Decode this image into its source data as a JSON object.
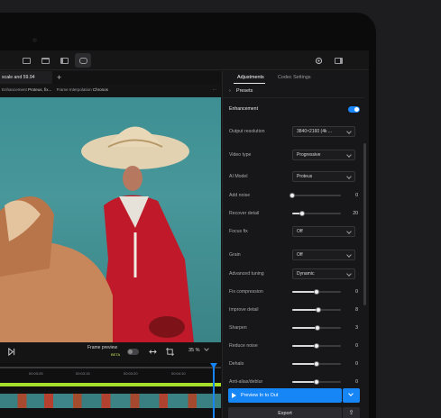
{
  "left": {
    "tab_label": "scale and 59.94",
    "info": {
      "enhancement_label": "Enhancement",
      "enhancement_value": "Proteus, fix...",
      "interp_label": "Frame Interpolation",
      "interp_value": "Chronos",
      "more": "···"
    },
    "controls": {
      "frame_preview": "Frame preview",
      "beta": "BETA",
      "zoom": "35 %"
    },
    "timecodes": [
      "00:03:25",
      "00:03:15",
      "00:03:20",
      "00:04:10"
    ]
  },
  "right": {
    "tabs": [
      "Adjustments",
      "Codec Settings"
    ],
    "presets": "Presets",
    "enhancement": "Enhancement",
    "rows": {
      "output_resolution": {
        "label": "Output resolution",
        "value": "3840×2160 (4k ..."
      },
      "video_type": {
        "label": "Video type",
        "value": "Progressive"
      },
      "ai_model": {
        "label": "AI Model",
        "value": "Proteus"
      },
      "add_noise": {
        "label": "Add noise",
        "value": "0"
      },
      "recover_detail": {
        "label": "Recover detail",
        "value": "20"
      },
      "focus_fix": {
        "label": "Focus fix",
        "value": "Off"
      },
      "grain": {
        "label": "Grain",
        "value": "Off"
      },
      "advanced_tuning": {
        "label": "Advanced tuning",
        "value": "Dynamic"
      },
      "fix_compression": {
        "label": "Fix compression",
        "value": "0"
      },
      "improve_detail": {
        "label": "Improve detail",
        "value": "8"
      },
      "sharpen": {
        "label": "Sharpen",
        "value": "3"
      },
      "reduce_noise": {
        "label": "Reduce noise",
        "value": "0"
      },
      "dehalo": {
        "label": "Dehalo",
        "value": "0"
      },
      "anti_alias": {
        "label": "Anti-alias/deblur",
        "value": "0"
      }
    },
    "buttons": {
      "preview": "Preview In to Out",
      "export": "Export"
    }
  },
  "colors": {
    "accent": "#1685f6",
    "timeline_green": "#a7e02b"
  }
}
